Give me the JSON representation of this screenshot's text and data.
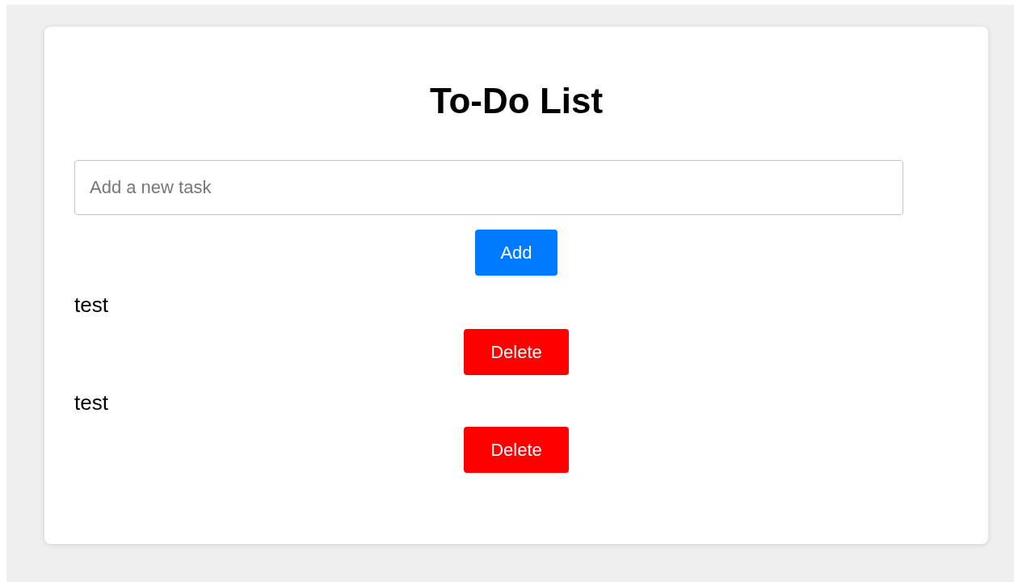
{
  "title": "To-Do List",
  "new_task": {
    "placeholder": "Add a new task"
  },
  "add_button": "Add",
  "tasks": [
    {
      "text": "test",
      "delete_button": "Delete"
    },
    {
      "text": "test",
      "delete_button": "Delete"
    }
  ]
}
